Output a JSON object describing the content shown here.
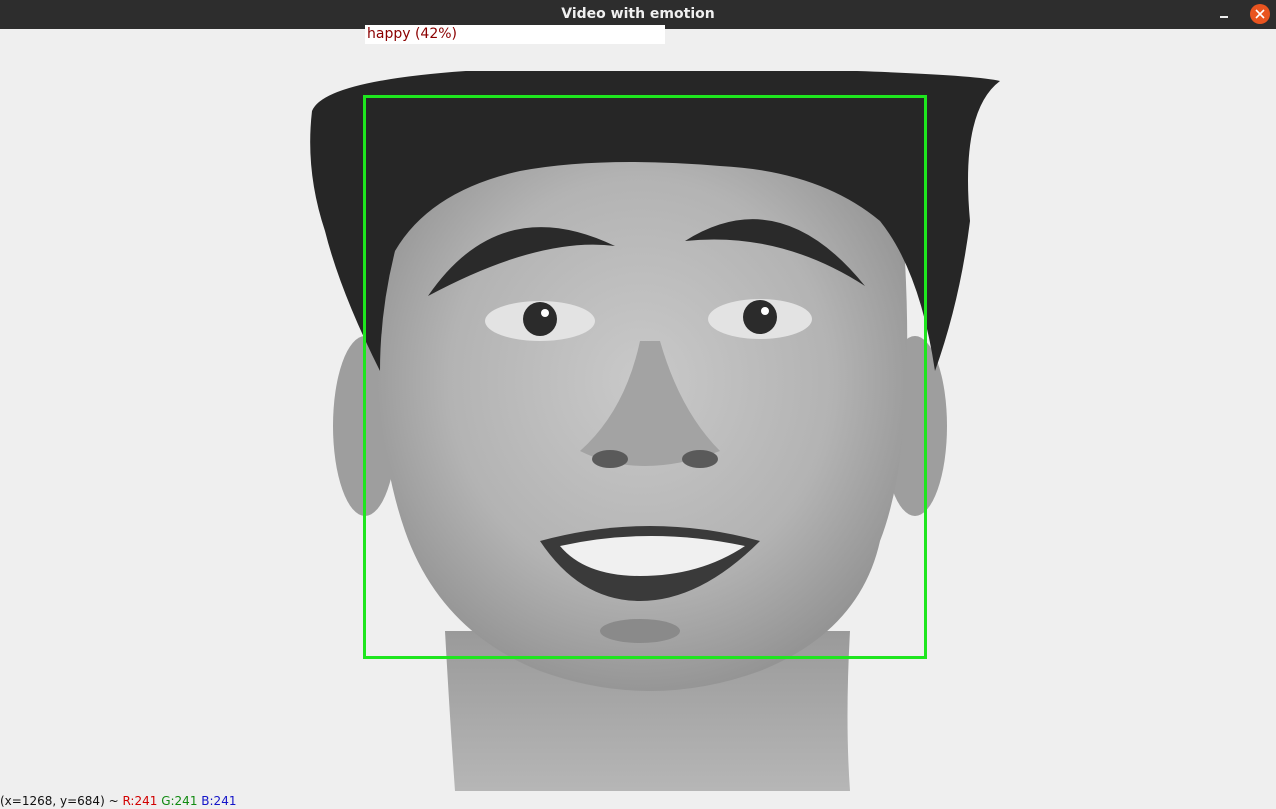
{
  "window": {
    "title": "Video with emotion"
  },
  "detection": {
    "emotion": "happy",
    "confidence_label": "(42%)",
    "label": "happy (42%)",
    "box_color": "#1ee61e",
    "label_color": "#8b0000"
  },
  "statusbar": {
    "coords": "(x=1268, y=684) ~",
    "r": "R:241",
    "g": "G:241",
    "b": "B:241",
    "r_color": "#d10000",
    "g_color": "#118a11",
    "b_color": "#1414c8"
  }
}
